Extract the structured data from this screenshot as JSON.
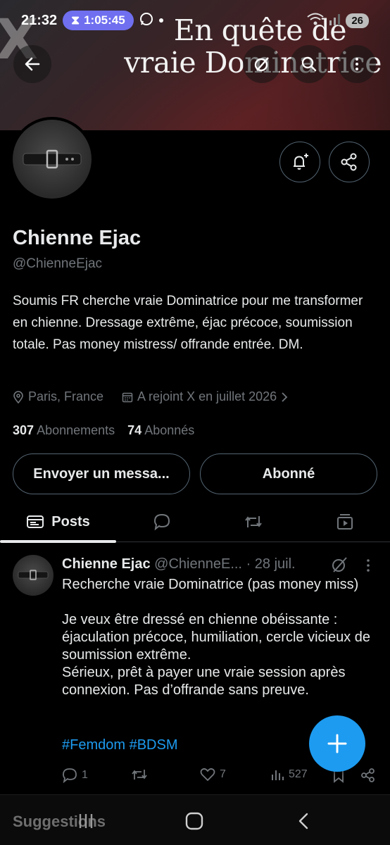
{
  "status_bar": {
    "time": "21:32",
    "timer": "1:05:45",
    "battery": "26"
  },
  "banner": {
    "line1": "En quête de",
    "line2": "vraie Dominatrice",
    "watermark": "X"
  },
  "profile": {
    "name": "Chienne Ejac",
    "handle": "@ChienneEjac",
    "bio": "Soumis FR cherche vraie Dominatrice pour me transformer en chienne. Dressage extrême, éjac précoce, soumission totale. Pas money mistress/ offrande entrée. DM.",
    "location": "Paris, France",
    "joined": "A rejoint X en juillet 2026",
    "following_count": "307",
    "following_label": "Abonnements",
    "followers_count": "74",
    "followers_label": "Abonnés"
  },
  "buttons": {
    "message": "Envoyer un messa...",
    "follow": "Abonné"
  },
  "tabs": {
    "posts": "Posts"
  },
  "post": {
    "author": "Chienne Ejac",
    "handle": "@ChienneE...",
    "date": "· 28 juil.",
    "text": "Recherche vraie Dominatrice (pas money miss)\n\nJe veux être dressé en chienne obéissante : éjaculation précoce, humiliation, cercle vicieux de soumission extrême.\nSérieux, prêt à payer une vraie session après connexion. Pas d’offrande sans preuve.",
    "hashtags": "#Femdom #BDSM",
    "replies": "1",
    "likes": "7",
    "views": "527"
  },
  "bottom": {
    "suggestions": "Suggestions"
  },
  "colors": {
    "accent": "#1d9bf0",
    "timer_pill": "#6f6ff0",
    "secondary_text": "#71767b"
  }
}
